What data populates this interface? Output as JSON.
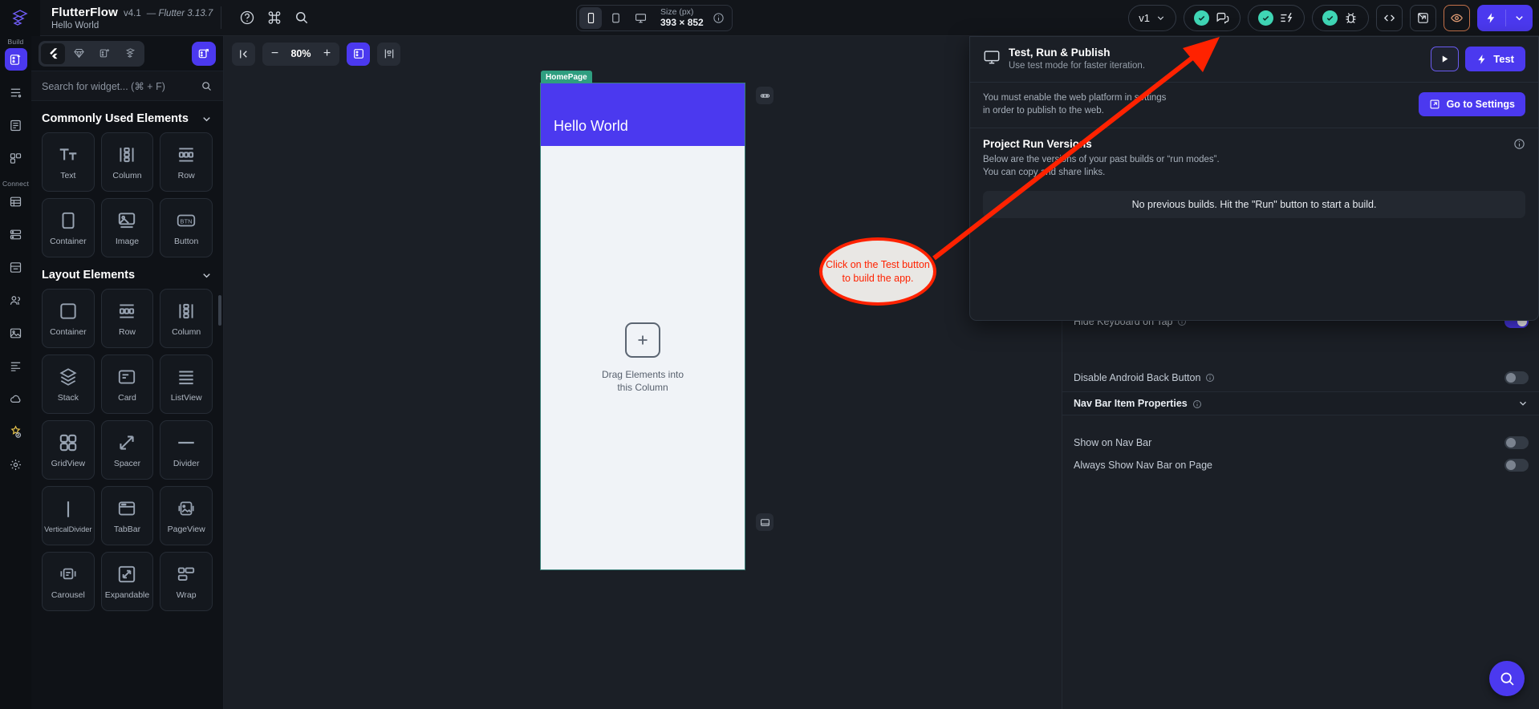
{
  "header": {
    "brand": "FlutterFlow",
    "version": "v4.1",
    "flutter_version": "— Flutter 3.13.7",
    "project_name": "Hello World",
    "icons": [
      "help-circle-icon",
      "command-icon",
      "search-icon"
    ],
    "device": {
      "size_label": "Size (px)",
      "size_value": "393 × 852",
      "options": [
        "phone-icon",
        "tablet-icon",
        "desktop-icon"
      ],
      "selected_index": 0
    },
    "version_pill": "v1",
    "right_icons": [
      "comment-icon",
      "lightning-check-icon",
      "bug-icon",
      "code-icon",
      "open-external-icon",
      "eye-icon",
      "run-bolt-icon"
    ]
  },
  "rail": {
    "build_label": "Build",
    "connect_label": "Connect",
    "items": [
      {
        "name": "widget-tree-icon"
      },
      {
        "name": "list-icon"
      },
      {
        "name": "pages-icon"
      },
      {
        "name": "components-icon"
      },
      {
        "name": "database-icon"
      },
      {
        "name": "api-icon"
      },
      {
        "name": "storage-icon"
      },
      {
        "name": "users-icon"
      },
      {
        "name": "media-icon"
      },
      {
        "name": "theme-icon"
      },
      {
        "name": "cloud-icon"
      },
      {
        "name": "tests-icon"
      },
      {
        "name": "settings-icon"
      }
    ]
  },
  "palette": {
    "tabs": [
      "flutter-icon",
      "gem-icon",
      "widget-add-icon",
      "flow-icon"
    ],
    "selected_tab": 0,
    "action_icon": "external-widget-icon",
    "search": {
      "placeholder": "Search for widget... (⌘ + F)"
    },
    "sections": [
      {
        "title": "Commonly Used Elements",
        "items": [
          {
            "label": "Text",
            "icon": "text-icon"
          },
          {
            "label": "Column",
            "icon": "column-icon"
          },
          {
            "label": "Row",
            "icon": "row-icon"
          },
          {
            "label": "Container",
            "icon": "container-icon"
          },
          {
            "label": "Image",
            "icon": "image-icon"
          },
          {
            "label": "Button",
            "icon": "button-icon"
          }
        ]
      },
      {
        "title": "Layout Elements",
        "items": [
          {
            "label": "Container",
            "icon": "container-icon"
          },
          {
            "label": "Row",
            "icon": "row-icon"
          },
          {
            "label": "Column",
            "icon": "column-icon"
          },
          {
            "label": "Stack",
            "icon": "stack-icon"
          },
          {
            "label": "Card",
            "icon": "card-icon"
          },
          {
            "label": "ListView",
            "icon": "listview-icon"
          },
          {
            "label": "GridView",
            "icon": "gridview-icon"
          },
          {
            "label": "Spacer",
            "icon": "spacer-icon"
          },
          {
            "label": "Divider",
            "icon": "divider-icon"
          },
          {
            "label": "VerticalDivider",
            "icon": "vertical-divider-icon"
          },
          {
            "label": "TabBar",
            "icon": "tabbar-icon"
          },
          {
            "label": "PageView",
            "icon": "pageview-icon"
          },
          {
            "label": "Carousel",
            "icon": "carousel-icon"
          },
          {
            "label": "Expandable",
            "icon": "expandable-icon"
          },
          {
            "label": "Wrap",
            "icon": "wrap-icon"
          }
        ]
      }
    ]
  },
  "canvas": {
    "zoom": "80%",
    "zoom_out": "−",
    "zoom_in": "+",
    "page_tag": "HomePage",
    "app_title": "Hello World",
    "placeholder_line1": "Drag Elements into",
    "placeholder_line2": "this Column"
  },
  "run_panel": {
    "title": "Test, Run & Publish",
    "subtitle": "Use test mode for faster iteration.",
    "play_icon": "play-icon",
    "test_label": "Test",
    "warning_line1": "You must enable the web platform in settings",
    "warning_line2": "in order to publish to the web.",
    "settings_label": "Go to Settings",
    "versions_title": "Project Run Versions",
    "versions_desc_line1": "Below are the versions of your past builds or “run modes”.",
    "versions_desc_line2": "You can copy and share links.",
    "empty_state": "No previous builds. Hit the \"Run\" button to start a build."
  },
  "properties": {
    "rows": [
      {
        "label": "Hide Keyboard on Tap",
        "toggle": "on"
      },
      {
        "label": "Disable Android Back Button",
        "toggle": "off"
      }
    ],
    "section_title": "Nav Bar Item Properties",
    "nav_rows": [
      {
        "label": "Show on Nav Bar",
        "toggle": "off"
      },
      {
        "label": "Always Show Nav Bar on Page",
        "toggle": "off"
      }
    ]
  },
  "annotation": {
    "callout_line1": "Click on the Test button",
    "callout_line2": "to build the app.",
    "arrow_color": "#ff2200"
  },
  "fab": {
    "icon": "search-help-icon"
  },
  "colors": {
    "accent": "#4b39ef",
    "success": "#3fd6b5",
    "annotation": "#ff2200",
    "page_tag": "#2f9e80"
  }
}
